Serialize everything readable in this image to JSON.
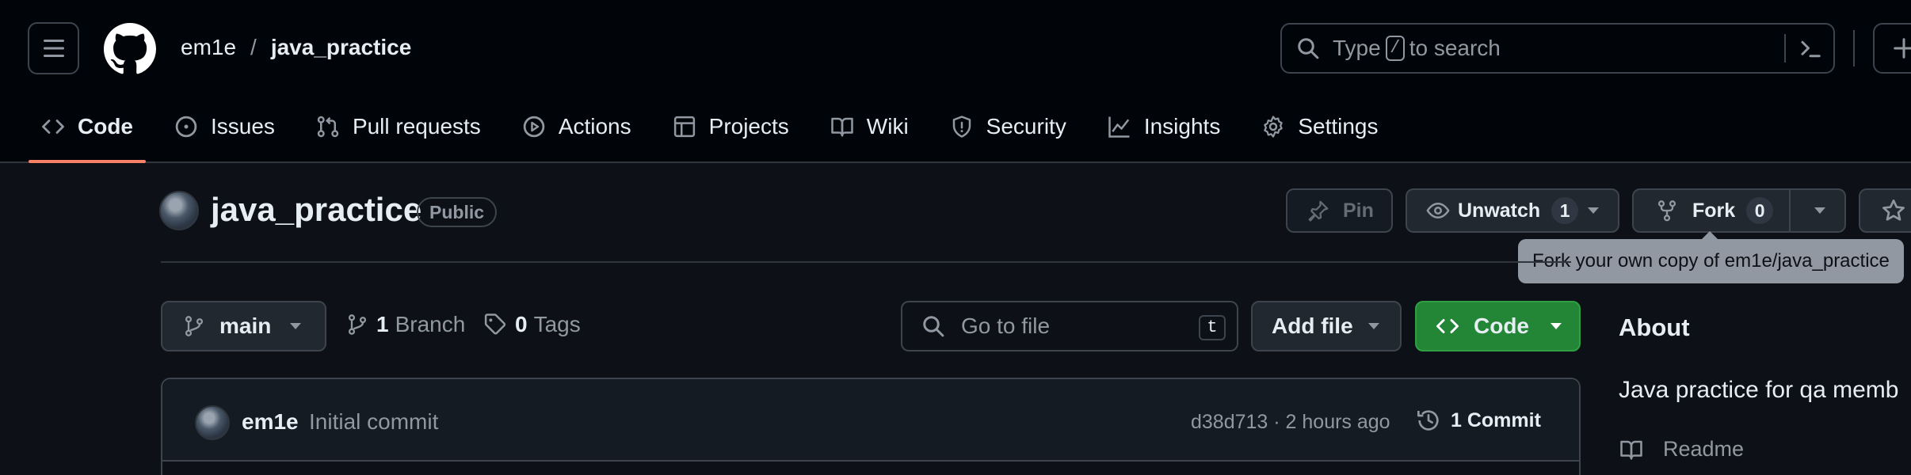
{
  "header": {
    "owner": "em1e",
    "separator": "/",
    "repo": "java_practice",
    "search": {
      "prefix": "Type",
      "key": "/",
      "suffix": "to search"
    }
  },
  "nav": {
    "tabs": [
      {
        "label": "Code",
        "icon": "code-icon",
        "active": true
      },
      {
        "label": "Issues",
        "icon": "issue-opened-icon"
      },
      {
        "label": "Pull requests",
        "icon": "git-pull-request-icon"
      },
      {
        "label": "Actions",
        "icon": "play-icon"
      },
      {
        "label": "Projects",
        "icon": "table-icon"
      },
      {
        "label": "Wiki",
        "icon": "book-icon"
      },
      {
        "label": "Security",
        "icon": "shield-icon"
      },
      {
        "label": "Insights",
        "icon": "graph-icon"
      },
      {
        "label": "Settings",
        "icon": "gear-icon"
      }
    ]
  },
  "repo": {
    "title": "java_practice",
    "visibility": "Public",
    "pin_label": "Pin",
    "unwatch_label": "Unwatch",
    "watch_count": "1",
    "fork_label": "Fork",
    "fork_count": "0",
    "fork_tooltip": "Fork your own copy of em1e/java_practice"
  },
  "toolbar": {
    "branch": "main",
    "branch_count": "1",
    "branch_label": "Branch",
    "tag_count": "0",
    "tag_label": "Tags",
    "goto_placeholder": "Go to file",
    "goto_key": "t",
    "add_file_label": "Add file",
    "code_label": "Code"
  },
  "commit": {
    "author": "em1e",
    "message": "Initial commit",
    "meta": "d38d713 · 2 hours ago",
    "count_label": "1 Commit"
  },
  "about": {
    "title": "About",
    "description": "Java practice for qa memb",
    "readme": "Readme"
  },
  "colors": {
    "background": "#0d1117",
    "header_bg": "#010409",
    "accent_underline": "#f78166",
    "code_button": "#238636",
    "muted_text": "#9198a1"
  }
}
